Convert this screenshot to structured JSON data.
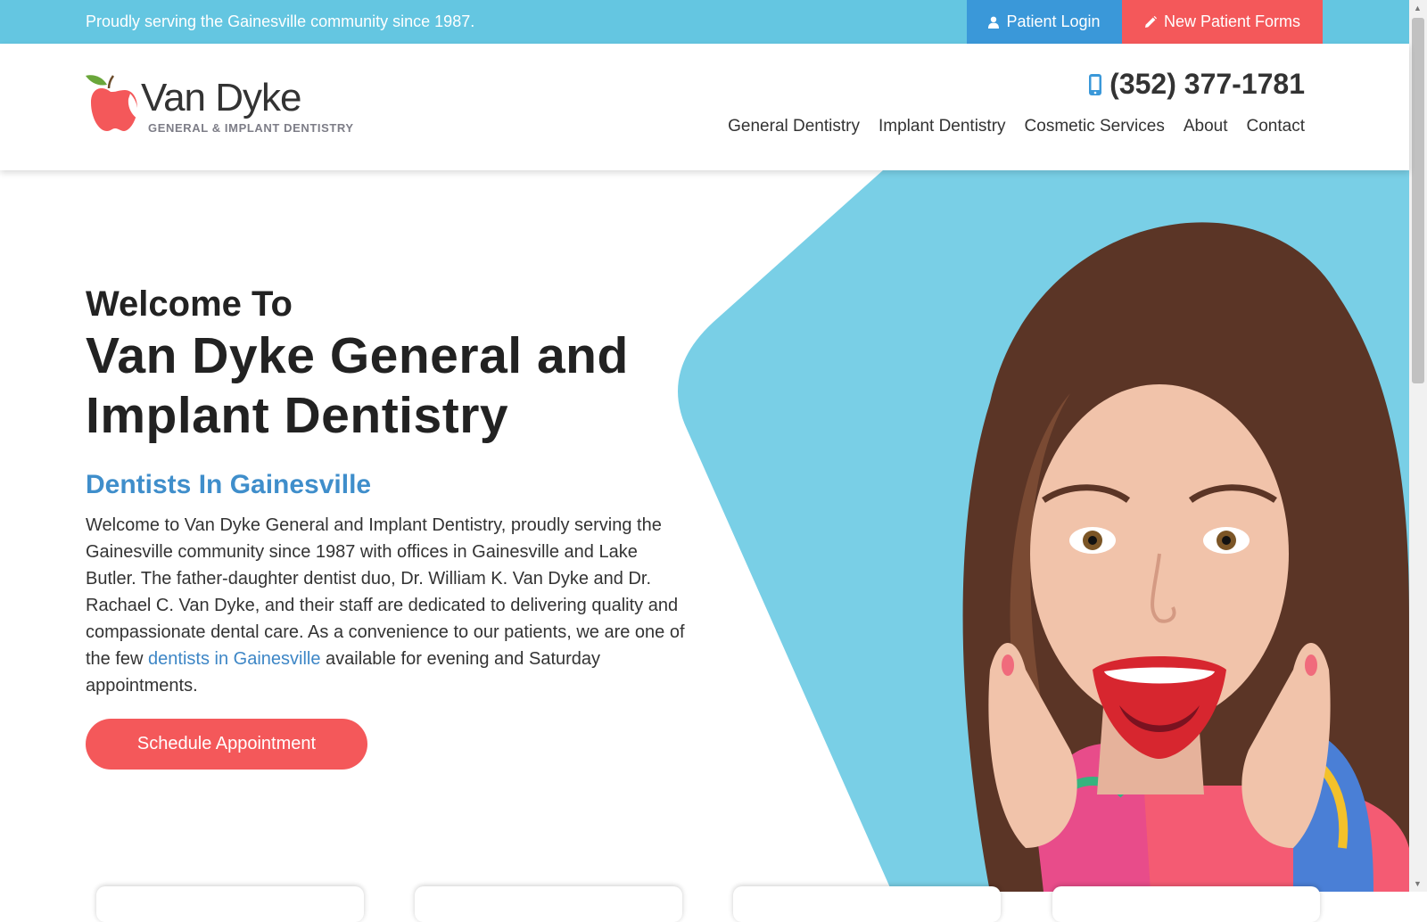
{
  "topbar": {
    "tagline": "Proudly serving the Gainesville community since 1987.",
    "patient_login": "Patient Login",
    "new_patient_forms": "New Patient Forms"
  },
  "header": {
    "logo_brand": "Van Dyke",
    "logo_sub": "GENERAL & IMPLANT DENTISTRY",
    "phone": "(352) 377-1781",
    "nav": [
      "General Dentistry",
      "Implant Dentistry",
      "Cosmetic Services",
      "About",
      "Contact"
    ]
  },
  "hero": {
    "welcome": "Welcome To",
    "title_line1": "Van Dyke General and",
    "title_line2": "Implant Dentistry",
    "subtitle": "Dentists In Gainesville",
    "body_part1": "Welcome to Van Dyke General and Implant Dentistry, proudly serving the Gainesville community since 1987 with offices in Gainesville and Lake Butler. The father-daughter dentist duo, Dr. William K. Van Dyke and Dr. Rachael C. Van Dyke, and their staff are dedicated to delivering quality and compassionate dental care. As a convenience to our patients, we are one of the few ",
    "body_link": "dentists in Gainesville",
    "body_part2": " available for evening and Saturday appointments.",
    "cta": "Schedule Appointment"
  },
  "icons": {
    "login": "user-icon",
    "forms": "pencil-icon",
    "phone": "mobile-phone-icon",
    "logo": "apple-icon"
  },
  "colors": {
    "topbar": "#64c6e1",
    "login_button": "#3a98d9",
    "accent_red": "#f4585a",
    "link_blue": "#3d86c6",
    "hero_shape": "#79cfe6"
  }
}
